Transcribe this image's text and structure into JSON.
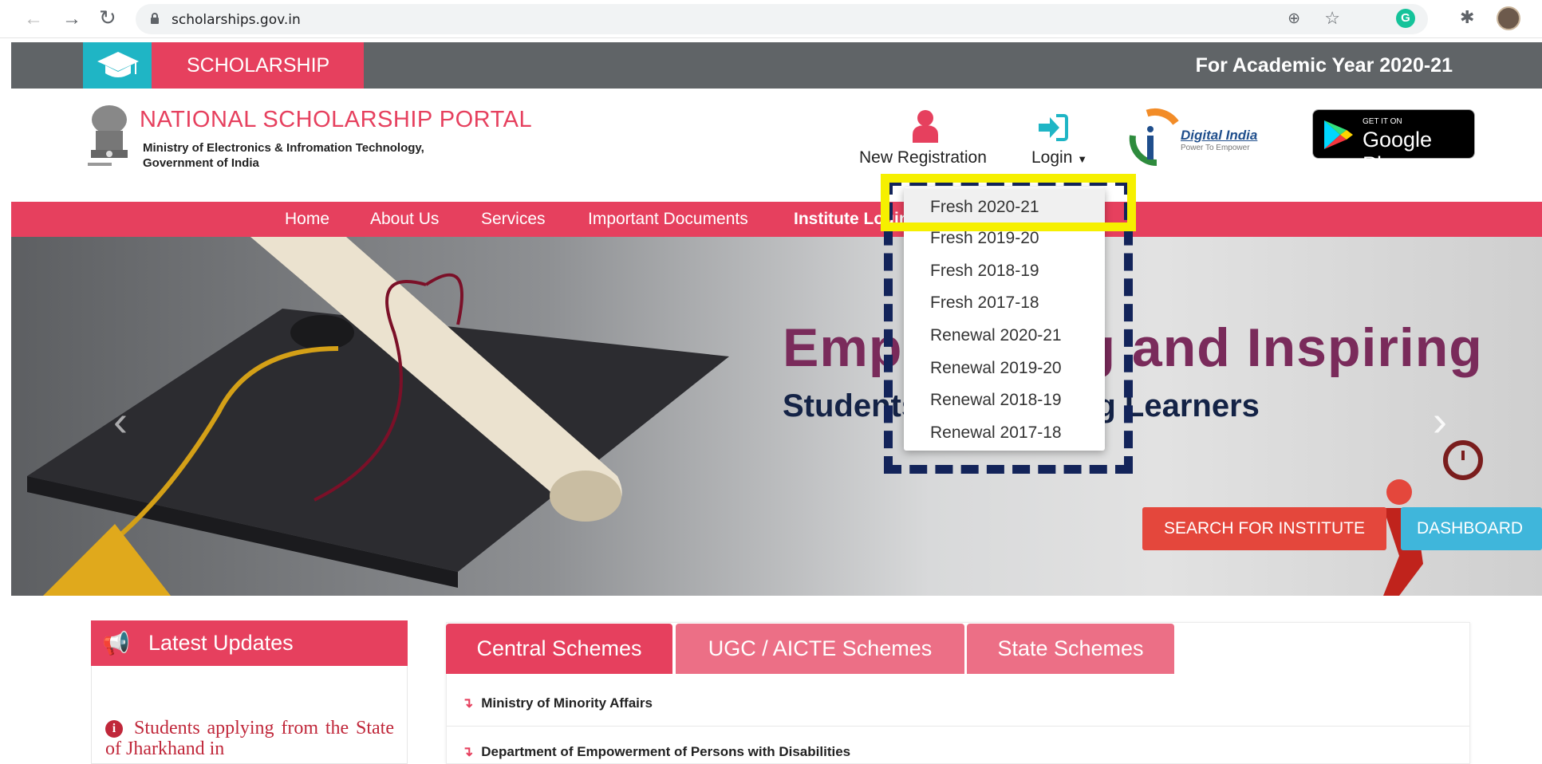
{
  "browser": {
    "url": "scholarships.gov.in"
  },
  "topbar": {
    "scholarship_label": "SCHOLARSHIP",
    "academic_year": "For Academic Year 2020-21"
  },
  "header": {
    "portal_name": "NATIONAL SCHOLARSHIP PORTAL",
    "ministry_line1": "Ministry of Electronics & Infromation Technology,",
    "ministry_line2": "Government of India",
    "new_registration": "New Registration",
    "login": "Login",
    "digital_india": "Digital India",
    "digital_india_tagline": "Power To Empower",
    "gplay_top": "GET IT ON",
    "gplay_main": "Google Play"
  },
  "nav": {
    "items": [
      "Home",
      "About Us",
      "Services",
      "Important Documents",
      "Institute Login"
    ]
  },
  "hero": {
    "title": "Empowering and Inspiring",
    "subtitle": "Students as Life Long Learners",
    "search_button": "SEARCH FOR INSTITUTE",
    "dashboard_button": "DASHBOARD"
  },
  "login_dropdown": {
    "options": [
      "Fresh 2020-21",
      "Fresh 2019-20",
      "Fresh 2018-19",
      "Fresh 2017-18",
      "Renewal 2020-21",
      "Renewal 2019-20",
      "Renewal 2018-19",
      "Renewal 2017-18"
    ]
  },
  "updates": {
    "heading": "Latest Updates",
    "text": "Students applying from the State of Jharkhand in"
  },
  "schemes": {
    "tabs": [
      "Central Schemes",
      "UGC / AICTE Schemes",
      "State Schemes"
    ],
    "rows": [
      "Ministry of Minority Affairs",
      "Department of Empowerment of Persons with Disabilities"
    ]
  },
  "colors": {
    "brand_red": "#e6405e",
    "teal": "#1fb5c5",
    "highlight_yellow": "#f6f000",
    "dashed_navy": "#13245a"
  }
}
